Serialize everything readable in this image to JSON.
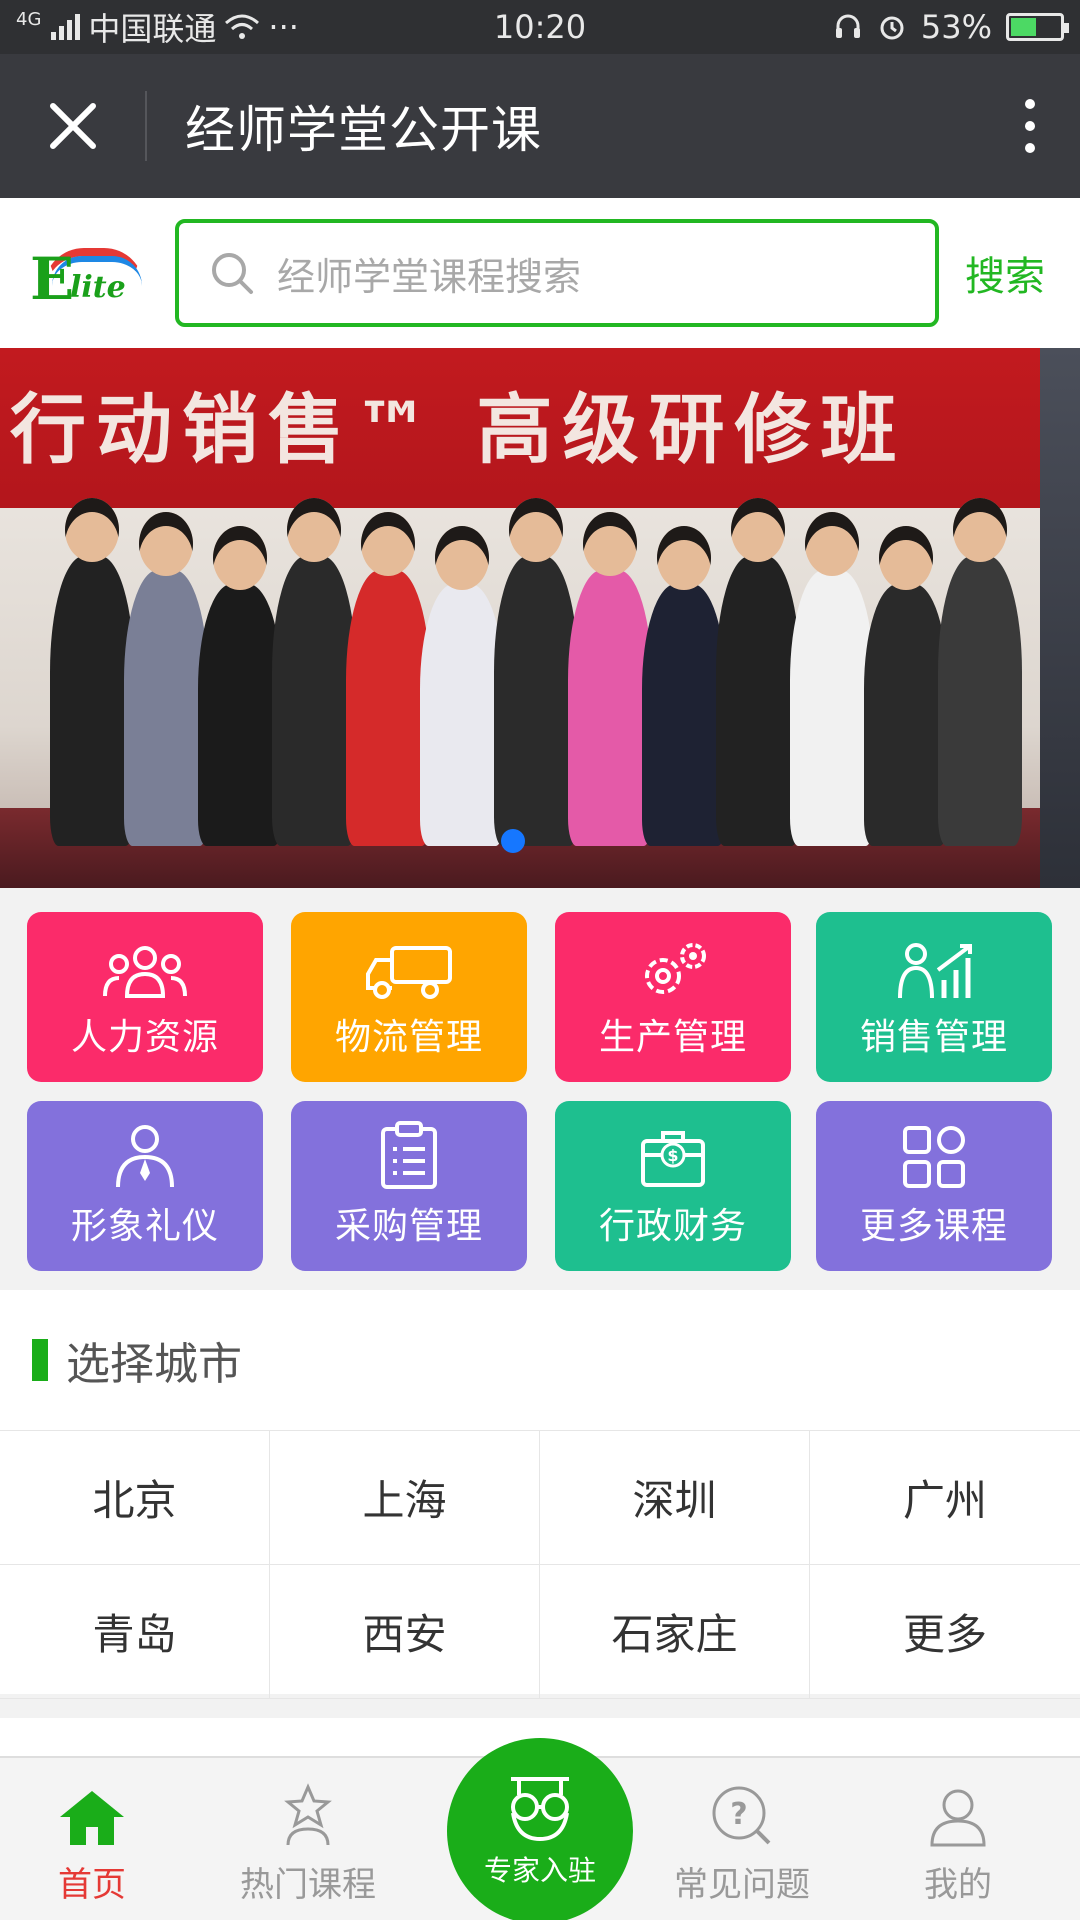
{
  "status_bar": {
    "network": "4G",
    "carrier": "中国联通",
    "dots": "···",
    "time": "10:20",
    "battery": "53%",
    "battery_level": 0.53
  },
  "title_bar": {
    "title": "经师学堂公开课"
  },
  "header": {
    "logo_text": "Elite",
    "search_placeholder": "经师学堂课程搜索",
    "search_button": "搜索"
  },
  "banner": {
    "slide_text": "行动销售™ 高级研修班",
    "active_slide": 1
  },
  "categories": [
    {
      "label": "人力资源",
      "icon": "people-group-icon",
      "color": "#fb2b6a"
    },
    {
      "label": "物流管理",
      "icon": "truck-icon",
      "color": "#ffa500"
    },
    {
      "label": "生产管理",
      "icon": "gears-icon",
      "color": "#fb2b6a"
    },
    {
      "label": "销售管理",
      "icon": "sales-chart-icon",
      "color": "#1ebf8f"
    },
    {
      "label": "形象礼仪",
      "icon": "person-tie-icon",
      "color": "#8371dc"
    },
    {
      "label": "采购管理",
      "icon": "clipboard-icon",
      "color": "#8371dc"
    },
    {
      "label": "行政财务",
      "icon": "briefcase-money-icon",
      "color": "#1ebf8f"
    },
    {
      "label": "更多课程",
      "icon": "grid-more-icon",
      "color": "#8371dc"
    }
  ],
  "cities": {
    "title": "选择城市",
    "rows": [
      [
        "北京",
        "上海",
        "深圳",
        "广州"
      ],
      [
        "青岛",
        "西安",
        "石家庄",
        "更多"
      ]
    ]
  },
  "bottom_nav": {
    "home": "首页",
    "hot_courses": "热门课程",
    "expert": "专家入驻",
    "faq": "常见问题",
    "mine": "我的",
    "active_color": "#e53935",
    "accent": "#1aad19"
  }
}
